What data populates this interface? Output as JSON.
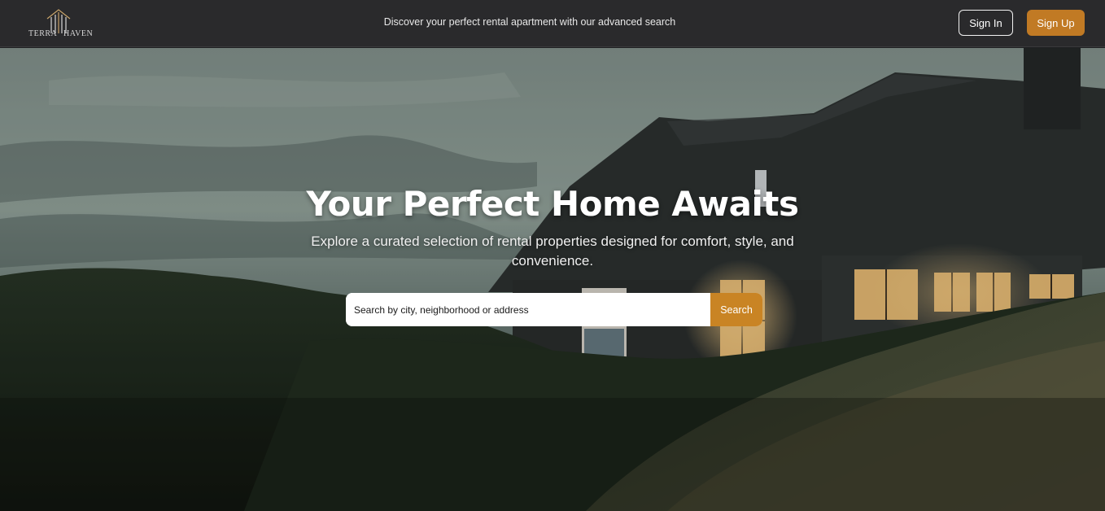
{
  "header": {
    "logo": {
      "left_word": "TERRA",
      "right_word": "HAVEN"
    },
    "tagline": "Discover your perfect rental apartment with our advanced search",
    "sign_in_label": "Sign In",
    "sign_up_label": "Sign Up"
  },
  "hero": {
    "title": "Your Perfect Home Awaits",
    "subtitle": "Explore a curated selection of rental properties designed for comfort, style, and convenience.",
    "search": {
      "placeholder": "Search by city, neighborhood or address",
      "value": "",
      "button_label": "Search"
    }
  },
  "colors": {
    "header_bg": "#2a2a2c",
    "accent": "#c17a24",
    "window_glow": "#f4c57a"
  }
}
